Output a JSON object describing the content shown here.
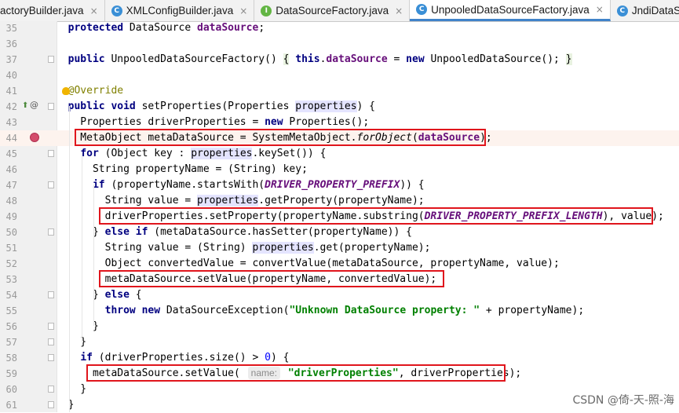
{
  "tabs": [
    {
      "label": "actoryBuilder.java",
      "icon": "class-c-icon",
      "icon_color": "#3a8fd6",
      "active": false,
      "icon_letter": ""
    },
    {
      "label": "XMLConfigBuilder.java",
      "icon": "class-c-icon",
      "icon_color": "#3a8fd6",
      "active": false,
      "icon_letter": "C"
    },
    {
      "label": "DataSourceFactory.java",
      "icon": "interface-i-icon",
      "icon_color": "#62b543",
      "active": false,
      "icon_letter": "I"
    },
    {
      "label": "UnpooledDataSourceFactory.java",
      "icon": "class-c-icon",
      "icon_color": "#3a8fd6",
      "active": true,
      "icon_letter": "C"
    },
    {
      "label": "JndiDataSourceFactory.java",
      "icon": "class-c-icon",
      "icon_color": "#3a8fd6",
      "active": false,
      "icon_letter": "C"
    }
  ],
  "lines": [
    {
      "n": "35",
      "html": "  <span class=\"kw\">protected</span> DataSource <span class=\"fld\">dataSource</span>;"
    },
    {
      "n": "36",
      "html": ""
    },
    {
      "n": "37",
      "html": "  <span class=\"kw\">public</span> UnpooledDataSourceFactory() <span class=\"brace\">{</span> <span class=\"kw\">this</span>.<span class=\"fld\">dataSource</span> = <span class=\"kw\">new</span> UnpooledDataSource(); <span class=\"brace\">}</span>"
    },
    {
      "n": "40",
      "html": ""
    },
    {
      "n": "41",
      "html": "  <span class=\"ann\">@Override</span>"
    },
    {
      "n": "42",
      "html": "  <span class=\"kw\">public void</span> setProperties(Properties <span class=\"par\">properties</span>) {"
    },
    {
      "n": "43",
      "html": "    Properties driverProperties = <span class=\"kw\">new</span> Properties();"
    },
    {
      "n": "44",
      "html": "    MetaObject metaDataSource = SystemMetaObject.<span class=\"itl\">forObject</span>(<span class=\"fld\">dataSource</span>);"
    },
    {
      "n": "45",
      "html": "    <span class=\"kw\">for</span> (Object key : <span class=\"par\">properties</span>.keySet()) {"
    },
    {
      "n": "46",
      "html": "      String propertyName = (String) key;"
    },
    {
      "n": "47",
      "html": "      <span class=\"kw\">if</span> (propertyName.startsWith(<span class=\"cst\">DRIVER_PROPERTY_PREFIX</span>)) {"
    },
    {
      "n": "48",
      "html": "        String value = <span class=\"par\">properties</span>.getProperty(propertyName);"
    },
    {
      "n": "49",
      "html": "        driverProperties.setProperty(propertyName.substring(<span class=\"cst\">DRIVER_PROPERTY_PREFIX_LENGTH</span>), value);"
    },
    {
      "n": "50",
      "html": "      } <span class=\"kw\">else if</span> (metaDataSource.hasSetter(propertyName)) {"
    },
    {
      "n": "51",
      "html": "        String value = (String) <span class=\"par\">properties</span>.get(propertyName);"
    },
    {
      "n": "52",
      "html": "        Object convertedValue = convertValue(metaDataSource, propertyName, value);"
    },
    {
      "n": "53",
      "html": "        metaDataSource.setValue(propertyName, convertedValue);"
    },
    {
      "n": "54",
      "html": "      } <span class=\"kw\">else</span> {"
    },
    {
      "n": "55",
      "html": "        <span class=\"kw\">throw new</span> DataSourceException(<span class=\"str\">\"Unknown DataSource property: \"</span> + propertyName);"
    },
    {
      "n": "56",
      "html": "      }"
    },
    {
      "n": "57",
      "html": "    }"
    },
    {
      "n": "58",
      "html": "    <span class=\"kw\">if</span> (driverProperties.size() &gt; <span class=\"num\">0</span>) {"
    },
    {
      "n": "59",
      "html": "      metaDataSource.setValue( <span class=\"hint\">name:</span> <span class=\"str\">\"driverProperties\"</span>, driverProperties);"
    },
    {
      "n": "60",
      "html": "    }"
    },
    {
      "n": "61",
      "html": "  }"
    }
  ],
  "highlight_line": "44",
  "watermark": "CSDN @倚-天-照-海"
}
